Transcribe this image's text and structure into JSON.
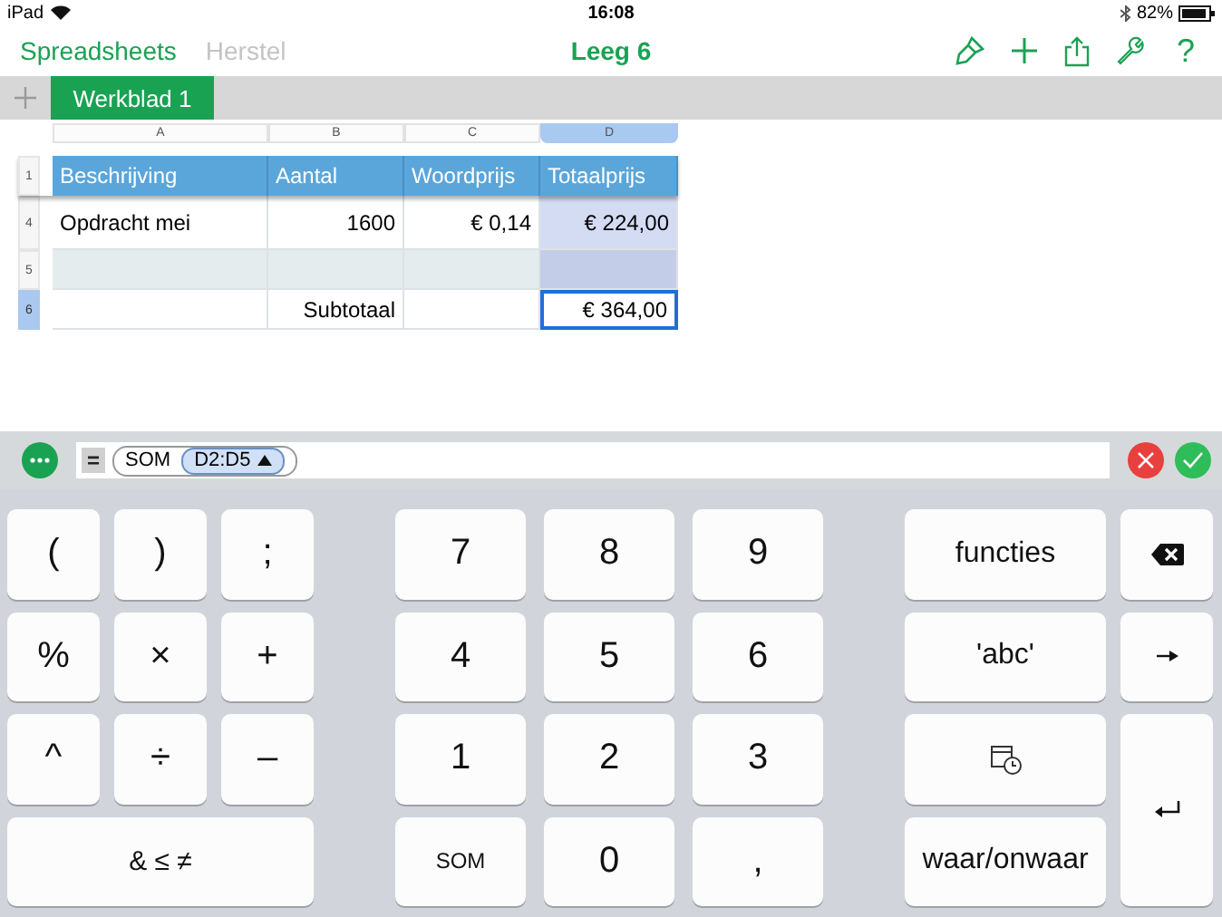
{
  "status_bar": {
    "device": "iPad",
    "time": "16:08",
    "battery": "82%"
  },
  "toolbar": {
    "back": "Spreadsheets",
    "undo": {
      "label": "Herstel",
      "disabled": true
    },
    "title": "Leeg 6",
    "help": "?"
  },
  "sheet_tabs": [
    {
      "label": "Werkblad 1",
      "selected": true
    }
  ],
  "table": {
    "columns": [
      {
        "letter": "A",
        "header": "Beschrijving",
        "selected": false
      },
      {
        "letter": "B",
        "header": "Aantal",
        "selected": false
      },
      {
        "letter": "C",
        "header": "Woordprijs",
        "selected": false
      },
      {
        "letter": "D",
        "header": "Totaalprijs",
        "selected": true
      }
    ],
    "header_row_number": "1",
    "rows": [
      {
        "number": "4",
        "selected": false,
        "shaded": false,
        "cells": [
          {
            "text": "Opdracht mei",
            "highlighted": false,
            "active": false
          },
          {
            "text": "1600",
            "highlighted": false,
            "active": false
          },
          {
            "text": "€ 0,14",
            "highlighted": false,
            "active": false
          },
          {
            "text": "€ 224,00",
            "highlighted": true,
            "active": false
          }
        ]
      },
      {
        "number": "5",
        "selected": false,
        "shaded": true,
        "cells": [
          {
            "highlighted": false,
            "active": false
          },
          {
            "highlighted": false,
            "active": false
          },
          {
            "highlighted": false,
            "active": false
          },
          {
            "highlighted": true,
            "active": false
          }
        ]
      },
      {
        "number": "6",
        "selected": true,
        "shaded": false,
        "cells": [
          {
            "highlighted": false,
            "active": false
          },
          {
            "text": "Subtotaal",
            "highlighted": false,
            "active": false
          },
          {
            "highlighted": false,
            "active": false
          },
          {
            "text": "€ 364,00",
            "highlighted": false,
            "active": true
          }
        ]
      }
    ]
  },
  "formula_bar": {
    "equals": "=",
    "tokens": [
      {
        "kind": "function",
        "text": "SOM"
      },
      {
        "kind": "range",
        "text": "D2:D5"
      }
    ]
  },
  "keyboard": {
    "left": [
      {
        "kind": "text",
        "label": "("
      },
      {
        "kind": "text",
        "label": ")"
      },
      {
        "kind": "text",
        "label": ";"
      },
      {
        "kind": "text",
        "label": "%"
      },
      {
        "kind": "text",
        "label": "×"
      },
      {
        "kind": "text",
        "label": "+"
      },
      {
        "kind": "text",
        "label": "^"
      },
      {
        "kind": "text",
        "label": "÷"
      },
      {
        "kind": "text",
        "label": "–"
      },
      {
        "kind": "wide",
        "label": "& ≤ ≠"
      }
    ],
    "middle": [
      {
        "kind": "text",
        "label": "7"
      },
      {
        "kind": "text",
        "label": "8"
      },
      {
        "kind": "text",
        "label": "9"
      },
      {
        "kind": "text",
        "label": "4"
      },
      {
        "kind": "text",
        "label": "5"
      },
      {
        "kind": "text",
        "label": "6"
      },
      {
        "kind": "text",
        "label": "1"
      },
      {
        "kind": "text",
        "label": "2"
      },
      {
        "kind": "text",
        "label": "3"
      },
      {
        "kind": "small",
        "label": "SOM"
      },
      {
        "kind": "text",
        "label": "0"
      },
      {
        "kind": "text",
        "label": ","
      }
    ],
    "right": [
      {
        "kind": "word",
        "label": "functies"
      },
      {
        "kind": "backspace"
      },
      {
        "kind": "word",
        "label": "'abc'"
      },
      {
        "kind": "tab"
      },
      {
        "kind": "date"
      },
      {
        "kind": "return"
      },
      {
        "kind": "word",
        "label": "waar/onwaar"
      }
    ]
  }
}
